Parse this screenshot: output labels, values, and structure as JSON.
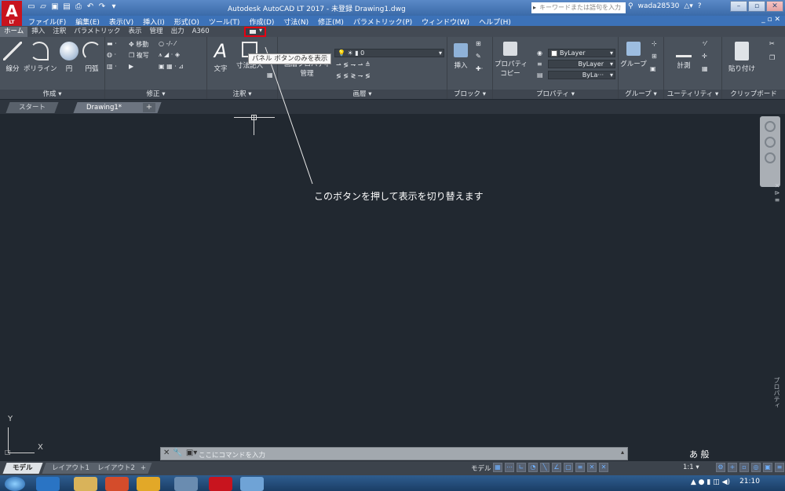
{
  "app": {
    "logo_text": "A",
    "logo_sub": "LT",
    "title": "Autodesk AutoCAD LT 2017 - 未登録   Drawing1.dwg",
    "search_placeholder": "キーワードまたは語句を入力",
    "user": "wada28530",
    "help": "?"
  },
  "menu": [
    "ファイル(F)",
    "編集(E)",
    "表示(V)",
    "挿入(I)",
    "形式(O)",
    "ツール(T)",
    "作成(D)",
    "寸法(N)",
    "修正(M)",
    "パラメトリック(P)",
    "ウィンドウ(W)",
    "ヘルプ(H)"
  ],
  "menu_right": "_ ▫ ✕",
  "ribbon_tabs": [
    "ホーム",
    "挿入",
    "注釈",
    "パラメトリック",
    "表示",
    "管理",
    "出力",
    "A360"
  ],
  "tooltip": "パネル ボタンのみを表示",
  "panels": {
    "draw": {
      "title": "作成 ▾",
      "tools": [
        "線分",
        "ポリライン",
        "円",
        "円弧"
      ]
    },
    "modify": {
      "title": "修正 ▾",
      "move": "移動",
      "copy": "複写"
    },
    "annotation": {
      "title": "注釈 ▾",
      "text": "文字",
      "dimension": "寸法記入"
    },
    "layers": {
      "title": "画層 ▾",
      "layer_value": "0",
      "properties": "画層プロパティ",
      "properties2": "管理"
    },
    "block": {
      "title": "ブロック ▾",
      "insert": "挿入"
    },
    "properties": {
      "title": "プロパティ ▾",
      "copy": "プロパティ",
      "copy2": "コピー",
      "color": "ByLayer",
      "linetype": "ByLayer",
      "lineweight": "ByLa···"
    },
    "groups": {
      "title": "グループ ▾",
      "group": "グループ"
    },
    "utilities": {
      "title": "ユーティリティ ▾",
      "measure": "計測"
    },
    "clipboard": {
      "title": "クリップボード",
      "paste": "貼り付け"
    }
  },
  "file_tabs": {
    "start": "スタート",
    "drawing": "Drawing1*",
    "close": "×",
    "add": "+"
  },
  "canvas": {
    "annotation": "このボタンを押して表示を切り替えます",
    "ucs_x": "X",
    "ucs_y": "Y"
  },
  "palette_label": "プロパティ",
  "command": {
    "prompt": "ここにコマンドを入力"
  },
  "ime": "あ 般",
  "layout_tabs": [
    "モデル",
    "レイアウト1",
    "レイアウト2"
  ],
  "layout_add": "+",
  "status": {
    "model": "モデル",
    "scale": "1:1 ▾"
  },
  "clock": "21:10",
  "colors": {
    "accent_red": "#e60012",
    "canvas": "#212830",
    "ribbon": "#4a525c"
  }
}
